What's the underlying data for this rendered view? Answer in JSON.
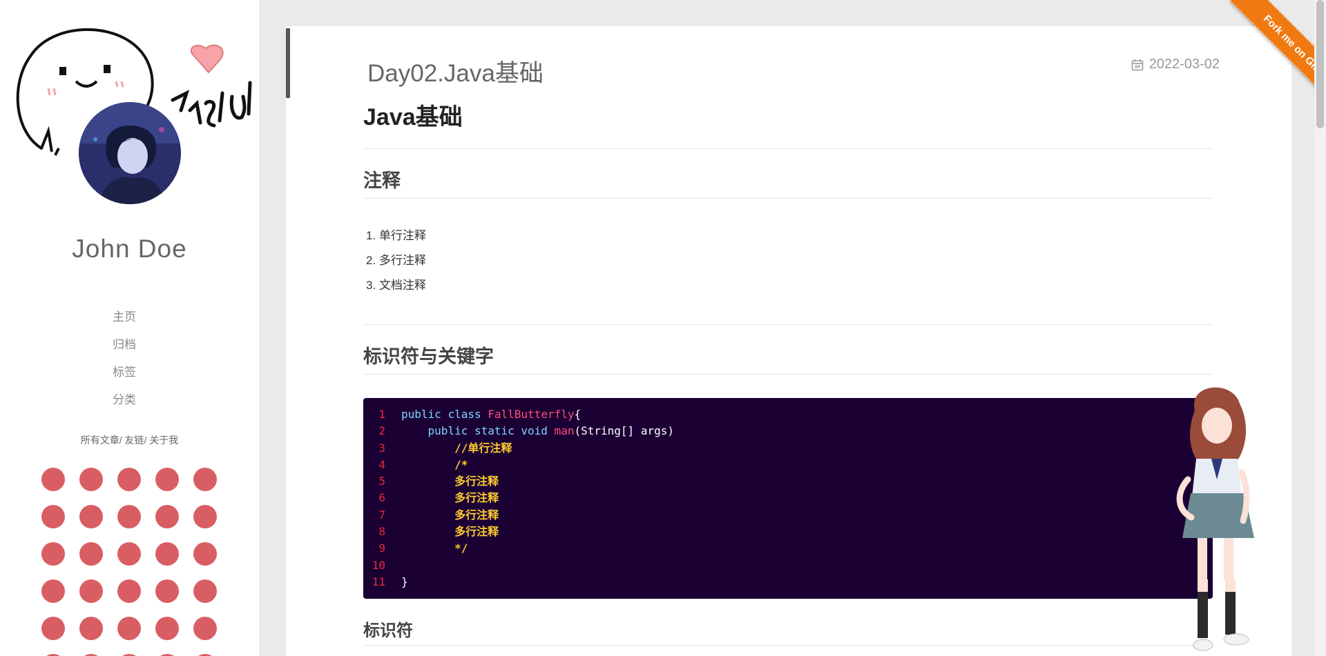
{
  "sidebar": {
    "author_name": "John Doe",
    "nav_items": [
      {
        "label": "主页"
      },
      {
        "label": "归档"
      },
      {
        "label": "标签"
      },
      {
        "label": "分类"
      }
    ],
    "links": [
      "所有文章/",
      "友链/",
      "关于我"
    ],
    "dot_color": "#d95e63"
  },
  "article": {
    "title": "Day02.Java基础",
    "date": "2022-03-02",
    "h1": "Java基础",
    "sections": {
      "comments_heading": "注释",
      "comment_types": [
        "1. 单行注释",
        "2. 多行注释",
        "3. 文档注释"
      ],
      "identifiers_heading": "标识符与关键字",
      "identifier_subheading": "标识符"
    },
    "code": {
      "line_numbers": [
        "1",
        "2",
        "3",
        "4",
        "5",
        "6",
        "7",
        "8",
        "9",
        "10",
        "11"
      ],
      "lines": [
        [
          "public",
          " ",
          "class",
          " ",
          "FallButterfly",
          "{"
        ],
        [
          "    ",
          "public",
          " ",
          "static",
          " ",
          "void",
          " ",
          "man",
          "(String[] args)"
        ],
        [
          "        //单行注释"
        ],
        [
          "        /*"
        ],
        [
          "        多行注释"
        ],
        [
          "        多行注释"
        ],
        [
          "        多行注释"
        ],
        [
          "        多行注释"
        ],
        [
          "        */"
        ],
        [
          ""
        ],
        [
          "}"
        ]
      ]
    }
  },
  "ribbon": {
    "label": "Fork me on GitHub",
    "color": "#f07a12"
  },
  "colors": {
    "code_bg": "#1b0034",
    "line_number": "#e8283b",
    "comment": "#ffcb2f",
    "keyword": "#7fd7ff",
    "function": "#ff4d7a"
  }
}
